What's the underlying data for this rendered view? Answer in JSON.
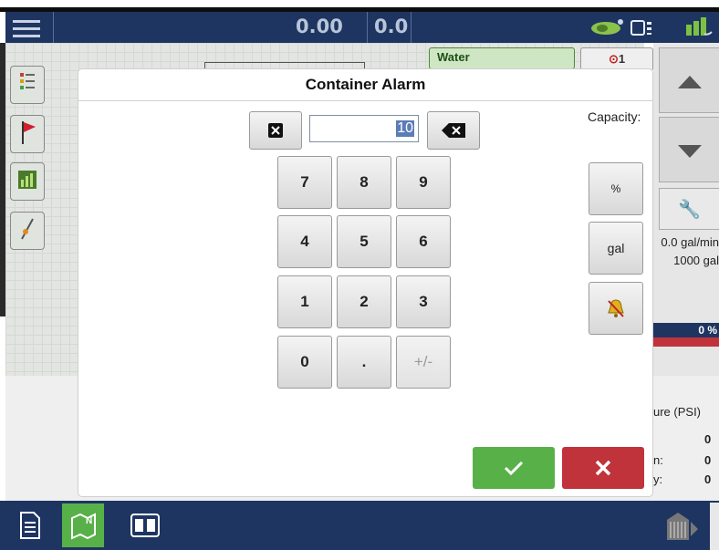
{
  "topbar": {
    "value1": "0.00",
    "value2": "0.0"
  },
  "background": {
    "product_tab": "Water",
    "alarm_count": "1",
    "rate_text": "0.0 gal/min",
    "volume_text": "1000 gal",
    "percent_text": "0 %",
    "pressure_header": "ure (PSI)",
    "pressure_rows": [
      {
        "label": "",
        "value": "0"
      },
      {
        "label": "n:",
        "value": "0"
      },
      {
        "label": "y:",
        "value": "0"
      }
    ]
  },
  "dialog": {
    "title": "Container Alarm",
    "capacity_label": "Capacity:",
    "input_value": "10",
    "keys": [
      "7",
      "8",
      "9",
      "4",
      "5",
      "6",
      "1",
      "2",
      "3",
      "0",
      ".",
      "+/-"
    ],
    "units": {
      "percent": "%",
      "gal": "gal"
    }
  },
  "colors": {
    "nav": "#1e3562",
    "ok": "#58b148",
    "cancel": "#c0333b"
  }
}
